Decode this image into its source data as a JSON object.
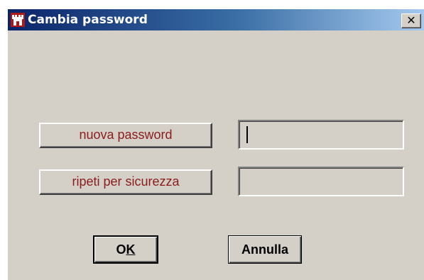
{
  "window": {
    "title": "Cambia password",
    "close_glyph": "✕"
  },
  "form": {
    "new_password_label": "nuova password",
    "confirm_password_label": "ripeti per sicurezza",
    "new_password_value": "",
    "confirm_password_value": ""
  },
  "buttons": {
    "ok_prefix": "O",
    "ok_mnemonic": "K",
    "cancel_label": "Annulla"
  },
  "colors": {
    "titlebar_start": "#0a246a",
    "titlebar_end": "#a6caf0",
    "label_text": "#8b1c1c",
    "dialog_face": "#d4d0c8"
  },
  "icons": {
    "app": "castle-icon",
    "close": "close-icon"
  }
}
